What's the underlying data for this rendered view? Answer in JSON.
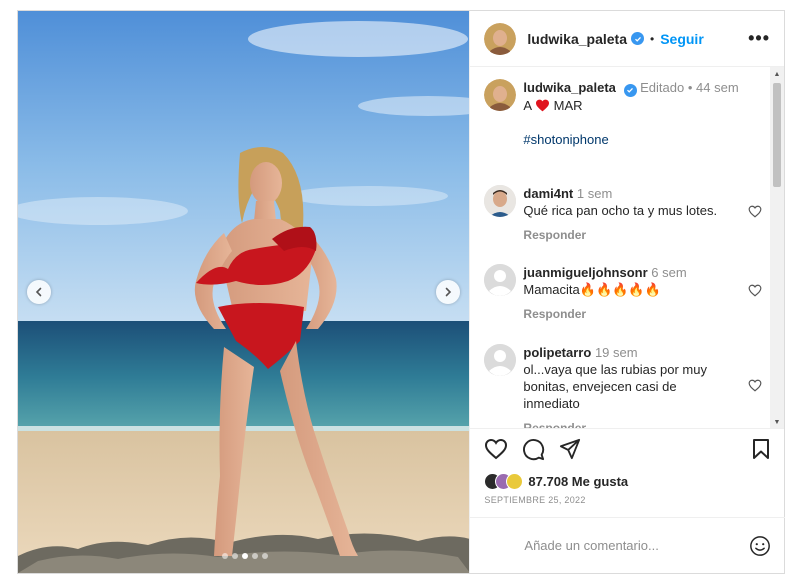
{
  "post": {
    "username": "ludwika_paleta",
    "follow_label": "Seguir",
    "more_label": "•••",
    "separator": "•",
    "verified_color": "#3897f0"
  },
  "caption": {
    "username": "ludwika_paleta",
    "edited": "Editado",
    "separator": "•",
    "age": "44 sem",
    "text_before": "A",
    "text_after": "MAR",
    "emoji": "red-heart",
    "hashtag": "#shotoniphone"
  },
  "comments": [
    {
      "username": "dami4nt",
      "age": "1 sem",
      "text": "Qué rica pan ocho ta y mus lotes.",
      "reply_label": "Responder",
      "avatar": "photo"
    },
    {
      "username": "juanmigueljohnsonr",
      "age": "6 sem",
      "text": "Mamacita🔥🔥🔥🔥🔥",
      "reply_label": "Responder",
      "avatar": "default"
    },
    {
      "username": "polipetarro",
      "age": "19 sem",
      "text": "ol...vaya que las rubias por muy bonitas, envejecen casi de inmediato",
      "reply_label": "Responder",
      "avatar": "default"
    }
  ],
  "stats": {
    "likes": "87.708 Me gusta",
    "date": "SEPTIEMBRE 25, 2022"
  },
  "composer": {
    "placeholder": "Añade un comentario..."
  },
  "carousel": {
    "slide_count": 5,
    "active_index": 2
  },
  "icons": {
    "like": "heart-outline-icon",
    "comment": "comment-bubble-icon",
    "share": "paper-plane-icon",
    "save": "bookmark-icon",
    "emoji": "smiley-icon",
    "prev": "chevron-left-icon",
    "next": "chevron-right-icon"
  },
  "colors": {
    "link_blue": "#0095f6",
    "hashtag": "#00376b",
    "muted": "#8e8e8e",
    "text": "#262626",
    "swimsuit_red": "#c8161e"
  }
}
